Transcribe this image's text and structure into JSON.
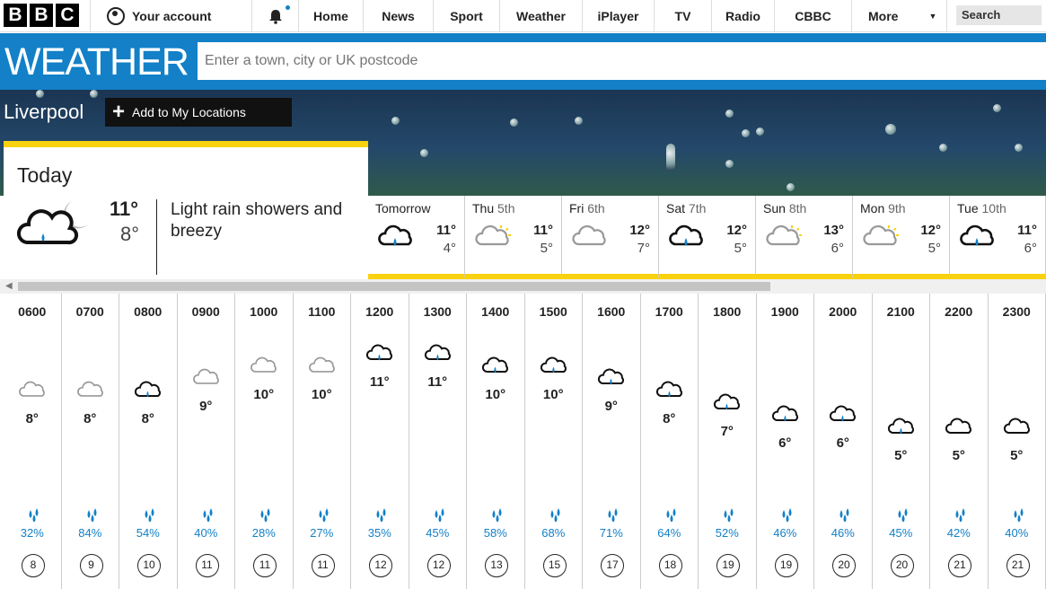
{
  "topnav": {
    "logo": [
      "B",
      "B",
      "C"
    ],
    "account": "Your account",
    "items": [
      "Home",
      "News",
      "Sport",
      "Weather",
      "iPlayer",
      "TV",
      "Radio",
      "CBBC",
      "More"
    ],
    "search": "Search"
  },
  "header": {
    "title": "WEATHER",
    "search_placeholder": "Enter a town, city or UK postcode"
  },
  "location": {
    "name": "Liverpool",
    "add_label": "Add to My Locations"
  },
  "today": {
    "label": "Today",
    "high": "11°",
    "low": "8°",
    "description": "Light rain showers and breezy",
    "icon": "cloud-rain-moon-icon"
  },
  "days": [
    {
      "name": "Tomorrow",
      "date": "",
      "high": "11°",
      "low": "4°",
      "icon": "cloud-rain"
    },
    {
      "name": "Thu",
      "date": "5th",
      "high": "11°",
      "low": "5°",
      "icon": "sun-cloud"
    },
    {
      "name": "Fri",
      "date": "6th",
      "high": "12°",
      "low": "7°",
      "icon": "cloud"
    },
    {
      "name": "Sat",
      "date": "7th",
      "high": "12°",
      "low": "5°",
      "icon": "cloud-rain"
    },
    {
      "name": "Sun",
      "date": "8th",
      "high": "13°",
      "low": "6°",
      "icon": "sun-cloud"
    },
    {
      "name": "Mon",
      "date": "9th",
      "high": "12°",
      "low": "5°",
      "icon": "sun-cloud"
    },
    {
      "name": "Tue",
      "date": "10th",
      "high": "11°",
      "low": "6°",
      "icon": "cloud-rain"
    }
  ],
  "hours": [
    {
      "time": "0600",
      "temp": "8°",
      "icon": "grey-cloud",
      "rain": "32%",
      "wind": "8",
      "level": 8
    },
    {
      "time": "0700",
      "temp": "8°",
      "icon": "grey-cloud",
      "rain": "84%",
      "wind": "9",
      "level": 8
    },
    {
      "time": "0800",
      "temp": "8°",
      "icon": "cloud-rain",
      "rain": "54%",
      "wind": "10",
      "level": 8
    },
    {
      "time": "0900",
      "temp": "9°",
      "icon": "grey-cloud",
      "rain": "40%",
      "wind": "11",
      "level": 9
    },
    {
      "time": "1000",
      "temp": "10°",
      "icon": "grey-cloud",
      "rain": "28%",
      "wind": "11",
      "level": 10
    },
    {
      "time": "1100",
      "temp": "10°",
      "icon": "grey-cloud",
      "rain": "27%",
      "wind": "11",
      "level": 10
    },
    {
      "time": "1200",
      "temp": "11°",
      "icon": "cloud-rain",
      "rain": "35%",
      "wind": "12",
      "level": 11
    },
    {
      "time": "1300",
      "temp": "11°",
      "icon": "cloud-rain",
      "rain": "45%",
      "wind": "12",
      "level": 11
    },
    {
      "time": "1400",
      "temp": "10°",
      "icon": "cloud-rain",
      "rain": "58%",
      "wind": "13",
      "level": 10
    },
    {
      "time": "1500",
      "temp": "10°",
      "icon": "cloud-rain",
      "rain": "68%",
      "wind": "15",
      "level": 10
    },
    {
      "time": "1600",
      "temp": "9°",
      "icon": "cloud-rain",
      "rain": "71%",
      "wind": "17",
      "level": 9
    },
    {
      "time": "1700",
      "temp": "8°",
      "icon": "cloud-rain",
      "rain": "64%",
      "wind": "18",
      "level": 8
    },
    {
      "time": "1800",
      "temp": "7°",
      "icon": "cloud-rain",
      "rain": "52%",
      "wind": "19",
      "level": 7
    },
    {
      "time": "1900",
      "temp": "6°",
      "icon": "cloud-rain",
      "rain": "46%",
      "wind": "19",
      "level": 6
    },
    {
      "time": "2000",
      "temp": "6°",
      "icon": "cloud-rain",
      "rain": "46%",
      "wind": "20",
      "level": 6
    },
    {
      "time": "2100",
      "temp": "5°",
      "icon": "cloud-rain",
      "rain": "45%",
      "wind": "20",
      "level": 5
    },
    {
      "time": "2200",
      "temp": "5°",
      "icon": "dark-cloud",
      "rain": "42%",
      "wind": "21",
      "level": 5
    },
    {
      "time": "2300",
      "temp": "5°",
      "icon": "dark-cloud",
      "rain": "40%",
      "wind": "21",
      "level": 5
    }
  ],
  "colors": {
    "brand_blue": "#1380c8",
    "accent_yellow": "#f8d20f"
  }
}
